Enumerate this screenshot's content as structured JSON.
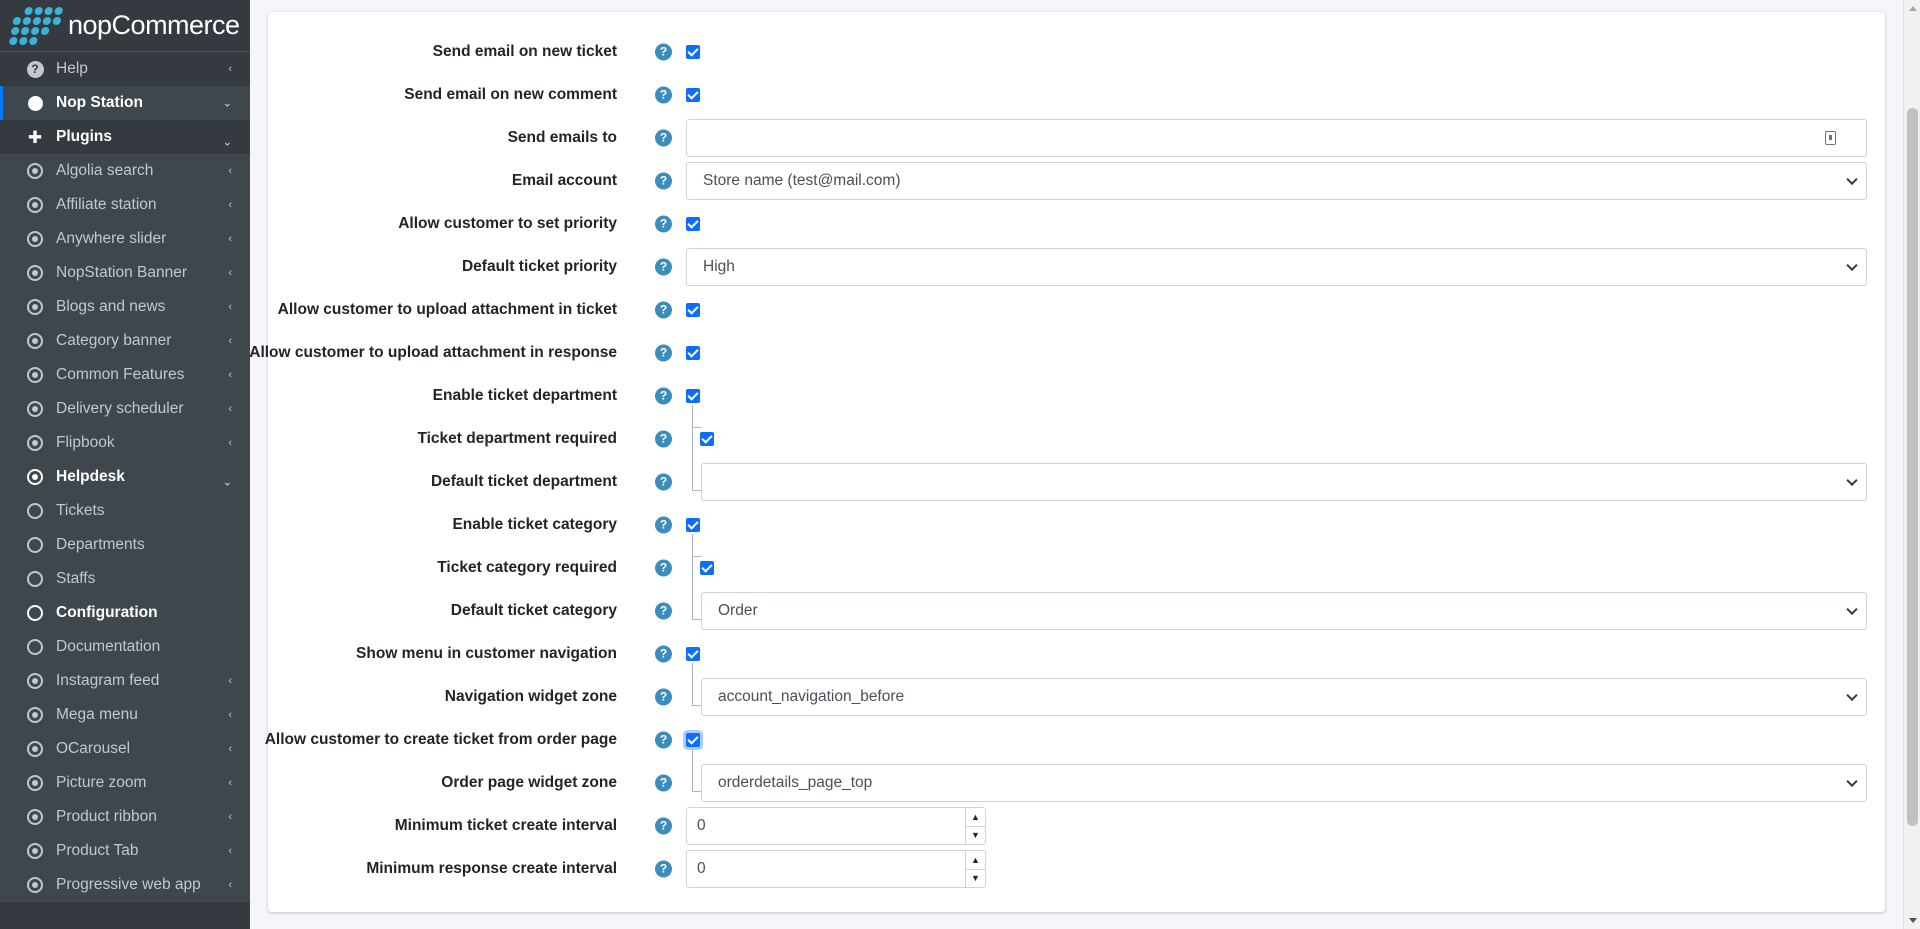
{
  "brand": {
    "name": "nopCommerce"
  },
  "sidebar": {
    "items": [
      {
        "label": "Help",
        "icon": "question-circle-icon",
        "arrow": "‹"
      },
      {
        "label": "Nop Station",
        "icon": "blob-icon",
        "arrow": "⌄"
      },
      {
        "label": "Plugins",
        "icon": "puzzle-icon",
        "arrow": "⌄"
      },
      {
        "label": "Algolia search",
        "icon": "circle-dot-icon",
        "arrow": "‹"
      },
      {
        "label": "Affiliate station",
        "icon": "circle-dot-icon",
        "arrow": "‹"
      },
      {
        "label": "Anywhere slider",
        "icon": "circle-dot-icon",
        "arrow": "‹"
      },
      {
        "label": "NopStation Banner",
        "icon": "circle-dot-icon",
        "arrow": "‹"
      },
      {
        "label": "Blogs and news",
        "icon": "circle-dot-icon",
        "arrow": "‹"
      },
      {
        "label": "Category banner",
        "icon": "circle-dot-icon",
        "arrow": "‹"
      },
      {
        "label": "Common Features",
        "icon": "circle-dot-icon",
        "arrow": "‹"
      },
      {
        "label": "Delivery scheduler",
        "icon": "circle-dot-icon",
        "arrow": "‹"
      },
      {
        "label": "Flipbook",
        "icon": "circle-dot-icon",
        "arrow": "‹"
      },
      {
        "label": "Helpdesk",
        "icon": "circle-dot-icon",
        "arrow": "⌄"
      },
      {
        "label": "Tickets",
        "icon": "circle-icon",
        "arrow": ""
      },
      {
        "label": "Departments",
        "icon": "circle-icon",
        "arrow": ""
      },
      {
        "label": "Staffs",
        "icon": "circle-icon",
        "arrow": ""
      },
      {
        "label": "Configuration",
        "icon": "circle-icon",
        "arrow": ""
      },
      {
        "label": "Documentation",
        "icon": "circle-icon",
        "arrow": ""
      },
      {
        "label": "Instagram feed",
        "icon": "circle-dot-icon",
        "arrow": "‹"
      },
      {
        "label": "Mega menu",
        "icon": "circle-dot-icon",
        "arrow": "‹"
      },
      {
        "label": "OCarousel",
        "icon": "circle-dot-icon",
        "arrow": "‹"
      },
      {
        "label": "Picture zoom",
        "icon": "circle-dot-icon",
        "arrow": "‹"
      },
      {
        "label": "Product ribbon",
        "icon": "circle-dot-icon",
        "arrow": "‹"
      },
      {
        "label": "Product Tab",
        "icon": "circle-dot-icon",
        "arrow": "‹"
      },
      {
        "label": "Progressive web app",
        "icon": "circle-dot-icon",
        "arrow": "‹"
      }
    ]
  },
  "form": {
    "help_glyph": "?",
    "send_email_new_ticket": {
      "label": "Send email on new ticket",
      "checked": true
    },
    "send_email_new_comment": {
      "label": "Send email on new comment",
      "checked": true
    },
    "send_emails_to": {
      "label": "Send emails to",
      "value": ""
    },
    "email_account": {
      "label": "Email account",
      "value": "Store name (test@mail.com)"
    },
    "allow_set_priority": {
      "label": "Allow customer to set priority",
      "checked": true
    },
    "default_ticket_priority": {
      "label": "Default ticket priority",
      "value": "High"
    },
    "allow_attach_ticket": {
      "label": "Allow customer to upload attachment in ticket",
      "checked": true
    },
    "allow_attach_response": {
      "label": "Allow customer to upload attachment in response",
      "checked": true
    },
    "enable_department": {
      "label": "Enable ticket department",
      "checked": true
    },
    "department_required": {
      "label": "Ticket department required",
      "checked": true
    },
    "default_department": {
      "label": "Default ticket department",
      "value": ""
    },
    "enable_category": {
      "label": "Enable ticket category",
      "checked": true
    },
    "category_required": {
      "label": "Ticket category required",
      "checked": true
    },
    "default_category": {
      "label": "Default ticket category",
      "value": "Order"
    },
    "show_menu_nav": {
      "label": "Show menu in customer navigation",
      "checked": true
    },
    "nav_widget_zone": {
      "label": "Navigation widget zone",
      "value": "account_navigation_before"
    },
    "allow_order_ticket": {
      "label": "Allow customer to create ticket from order page",
      "checked": true
    },
    "order_widget_zone": {
      "label": "Order page widget zone",
      "value": "orderdetails_page_top"
    },
    "min_ticket_interval": {
      "label": "Minimum ticket create interval",
      "value": "0"
    },
    "min_response_interval": {
      "label": "Minimum response create interval",
      "value": "0"
    },
    "spin_up": "▲",
    "spin_down": "▼"
  },
  "colors": {
    "sidebar_bg": "#343a40",
    "accent": "#007bff",
    "help": "#3c8dbc",
    "checkbox": "#0d6efd"
  }
}
